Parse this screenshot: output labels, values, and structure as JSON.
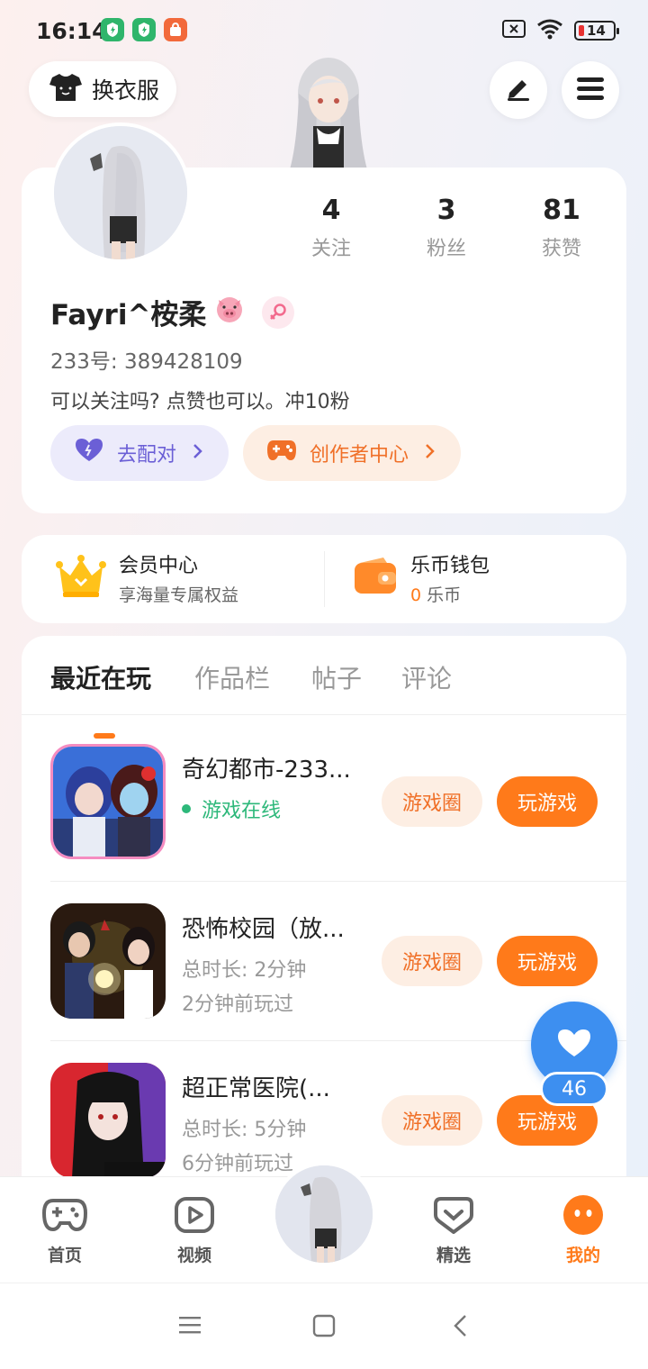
{
  "status_bar": {
    "time": "16:14",
    "battery_level": "14",
    "icons": [
      "app-shield-icon",
      "app-shield-icon",
      "app-store-icon",
      "sim-off-icon",
      "wifi-icon",
      "battery-icon"
    ]
  },
  "header": {
    "outfit_label": "换衣服",
    "edit_icon": "pencil-icon",
    "menu_icon": "hamburger-icon"
  },
  "profile": {
    "stats": [
      {
        "value": "4",
        "label": "关注"
      },
      {
        "value": "3",
        "label": "粉丝"
      },
      {
        "value": "81",
        "label": "获赞"
      }
    ],
    "username": "Fayri^桉柔",
    "id_line": "233号: 389428109",
    "bio": "可以关注吗? 点赞也可以。冲10粉",
    "match_label": "去配对",
    "creator_label": "创作者中心"
  },
  "wallet": {
    "vip_title": "会员中心",
    "vip_subtitle": "享海量专属权益",
    "coin_title": "乐币钱包",
    "coin_amount": "0",
    "coin_unit": "乐币"
  },
  "tabs": [
    "最近在玩",
    "作品栏",
    "帖子",
    "评论"
  ],
  "games": [
    {
      "name": "奇幻都市-233...",
      "meta1": "游戏在线",
      "meta2": "",
      "online": true,
      "circle_label": "游戏圈",
      "play_label": "玩游戏"
    },
    {
      "name": "恐怖校园（放...",
      "meta1": "总时长: 2分钟",
      "meta2": "2分钟前玩过",
      "online": false,
      "circle_label": "游戏圈",
      "play_label": "玩游戏"
    },
    {
      "name": "超正常医院(...",
      "meta1": "总时长: 5分钟",
      "meta2": "6分钟前玩过",
      "online": false,
      "circle_label": "游戏圈",
      "play_label": "玩游戏"
    }
  ],
  "like_count": "46",
  "nav": [
    {
      "label": "首页",
      "icon": "gamepad-icon"
    },
    {
      "label": "视频",
      "icon": "video-icon"
    },
    {
      "label": "精选",
      "icon": "heart-chat-icon"
    },
    {
      "label": "我的",
      "icon": "face-icon"
    }
  ],
  "colors": {
    "accent": "#ff7a1a",
    "fab": "#3d8ff0",
    "online": "#2db87a",
    "match": "#6b5fd6"
  }
}
